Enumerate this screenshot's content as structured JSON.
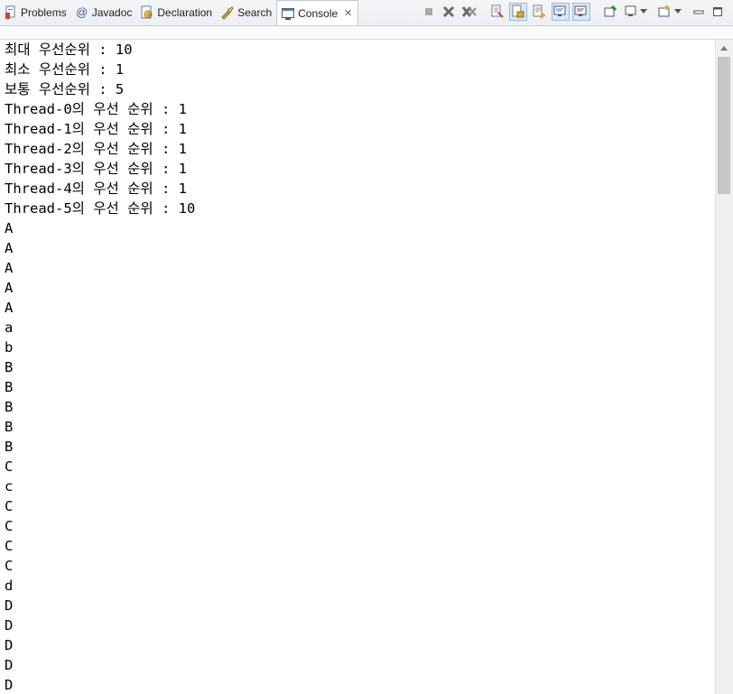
{
  "tabs": [
    {
      "label": "Problems",
      "icon": "problems-icon"
    },
    {
      "label": "Javadoc",
      "icon": "at-icon"
    },
    {
      "label": "Declaration",
      "icon": "declaration-icon"
    },
    {
      "label": "Search",
      "icon": "flashlight-icon"
    },
    {
      "label": "Console",
      "icon": "console-icon",
      "active": true
    }
  ],
  "colors": {
    "tab_bar": "#eceff3",
    "console_bg": "#ffffff",
    "text": "#000000",
    "scrollbar_thumb": "#c6c6c6",
    "pressed_button": "#dbe7f5"
  },
  "console": {
    "lines": [
      "최대 우선순위 : 10",
      "최소 우선순위 : 1",
      "보통 우선순위 : 5",
      "Thread-0의 우선 순위 : 1",
      "Thread-1의 우선 순위 : 1",
      "Thread-2의 우선 순위 : 1",
      "Thread-3의 우선 순위 : 1",
      "Thread-4의 우선 순위 : 1",
      "Thread-5의 우선 순위 : 10",
      "A",
      "A",
      "A",
      "A",
      "A",
      "a",
      "b",
      "B",
      "B",
      "B",
      "B",
      "B",
      "C",
      "c",
      "C",
      "C",
      "C",
      "C",
      "d",
      "D",
      "D",
      "D",
      "D",
      "D"
    ]
  }
}
